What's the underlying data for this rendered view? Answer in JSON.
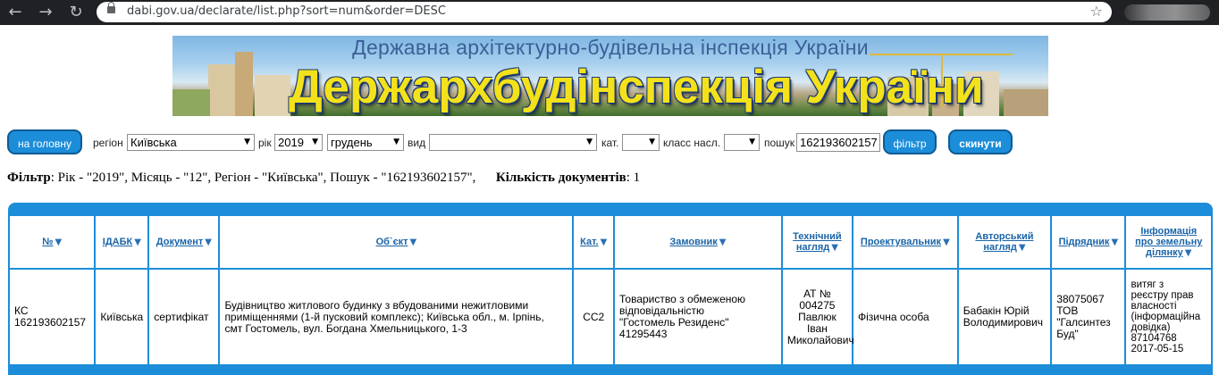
{
  "browser": {
    "url": "dabi.gov.ua/declarate/list.php?sort=num&order=DESC",
    "icons": {
      "back": "arrow-left-icon",
      "forward": "arrow-right-icon",
      "reload": "reload-icon",
      "lock": "lock-icon",
      "star": "star-icon"
    }
  },
  "banner": {
    "subtitle": "Державна архітектурно-будівельна інспекція України",
    "title": "Держархбудінспекція України"
  },
  "filters": {
    "home_button": "на головну",
    "region_label": "регіон",
    "region_value": "Київська",
    "year_label": "рік",
    "year_value": "2019",
    "month_value": "грудень",
    "type_label": "вид",
    "type_value": "",
    "category_label": "кат.",
    "category_value": "",
    "class_label": "класс насл.",
    "class_value": "",
    "search_label": "пошук",
    "search_value": "162193602157",
    "filter_button": "фільтр",
    "reset_button": "скинути"
  },
  "summary": {
    "filter_label": "Фільтр",
    "filter_text": ": Рік - \"2019\", Місяць - \"12\", Регіон - \"Київська\", Пошук - \"162193602157\",",
    "count_label": "Кількість документів",
    "count_value": ": 1"
  },
  "table": {
    "columns": [
      {
        "line1": "№",
        "line2": ""
      },
      {
        "line1": "ІДАБК",
        "line2": ""
      },
      {
        "line1": "Документ",
        "line2": ""
      },
      {
        "line1": "Об`єкт",
        "line2": ""
      },
      {
        "line1": "Кат.",
        "line2": ""
      },
      {
        "line1": "Замовник",
        "line2": ""
      },
      {
        "line1": "Технічний",
        "line2": "нагляд"
      },
      {
        "line1": "Проектувальник",
        "line2": ""
      },
      {
        "line1": "Авторський",
        "line2": "нагляд"
      },
      {
        "line1": "Підрядник",
        "line2": ""
      },
      {
        "line1": "Інформація",
        "line2": "про земельну",
        "line3": "ділянку"
      }
    ],
    "rows": [
      {
        "num": [
          "КС",
          "162193602157"
        ],
        "idabk": "Київська",
        "document": "сертифікат",
        "object": [
          "Будівництво житлового будинку з вбудованими нежитловими",
          "приміщеннями (1-й пусковий комплекс); Київська обл., м. Ірпінь,",
          "смт Гостомель, вул. Богдана Хмельницького, 1-3"
        ],
        "category": "СС2",
        "customer": [
          "Товариство з обмеженою",
          "відповідальністю",
          "\"Гостомель Резиденс\"",
          "41295443"
        ],
        "tech_supervision": [
          "АТ № 004275",
          "Павлюк Іван",
          "Миколайович"
        ],
        "designer": "Фізична особа",
        "author_supervision": [
          "Бабакін Юрій",
          "Володимирович"
        ],
        "contractor": [
          "38075067",
          "ТОВ",
          "\"Галсинтез",
          "Буд\""
        ],
        "land_info": [
          "витяг з",
          "реєстру прав",
          "власності",
          "(інформаційна",
          "довідка)",
          "87104768",
          "2017-05-15"
        ]
      }
    ]
  },
  "colors": {
    "accent": "#1c8dd8",
    "header_link": "#1a64a8",
    "banner_title": "#f3e21a"
  }
}
